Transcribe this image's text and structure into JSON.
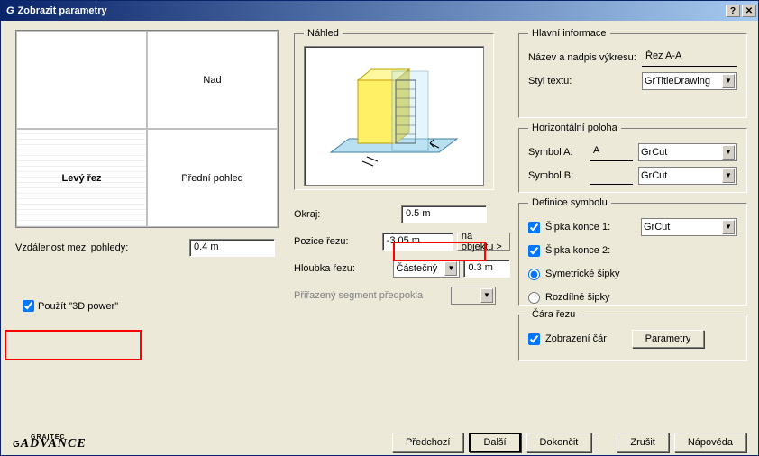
{
  "titlebar": {
    "title": "Zobrazit parametry"
  },
  "views": {
    "top_left": "",
    "top_right": "Nad",
    "bottom_left": "Levý řez",
    "bottom_right": "Přední pohled"
  },
  "left": {
    "dist_label": "Vzdálenost mezi pohledy:",
    "dist_value": "0.4 m",
    "use3d_label": "Použít \"3D power\""
  },
  "nahled": {
    "title": "Náhled"
  },
  "mid": {
    "okraj_label": "Okraj:",
    "okraj_value": "0.5 m",
    "pozice_label": "Pozice řezu:",
    "pozice_value": "-3.05 m",
    "naobj": "na objektu >",
    "hloubka_label": "Hloubka řezu:",
    "hloubka_sel": "Částečný",
    "hloubka_value": "0.3 m",
    "prirazeny_label": "Přiřazený segment předpokla"
  },
  "hlavni": {
    "title": "Hlavní informace",
    "nazev_label": "Název a nadpis výkresu:",
    "nazev_value": "Řez A-A",
    "styl_label": "Styl textu:",
    "styl_value": "GrTitleDrawing"
  },
  "horiz": {
    "title": "Horizontální poloha",
    "symA_label": "Symbol A:",
    "symA_value": "A",
    "symA_sel": "GrCut",
    "symB_label": "Symbol B:",
    "symB_sel": "GrCut"
  },
  "def": {
    "title": "Definice symbolu",
    "sip1_label": "Šipka konce 1:",
    "sip1_sel": "GrCut",
    "sip2_label": "Šipka konce 2:",
    "sym_label": "Symetrické šipky",
    "roz_label": "Rozdílné šipky"
  },
  "cara": {
    "title": "Čára řezu",
    "zob_label": "Zobrazení čár",
    "param_btn": "Parametry"
  },
  "footer": {
    "prev": "Předchozí",
    "next": "Další",
    "finish": "Dokončit",
    "cancel": "Zrušit",
    "help": "Nápověda"
  }
}
